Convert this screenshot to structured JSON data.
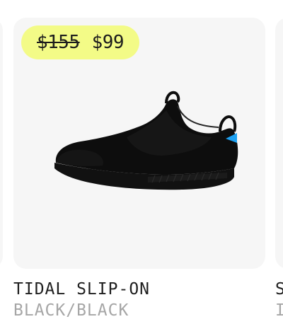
{
  "product": {
    "name": "TIDAL SLIP-ON",
    "color": "BLACK/BLACK",
    "price_original": "$155",
    "price_sale": "$99",
    "image_icon": "black-slip-on-sneaker",
    "accent_color": "#1da1f2"
  },
  "colors": {
    "badge_background": "#f3fb87",
    "card_background": "#f6f6f6",
    "name_text": "#1f1f1f",
    "color_text": "#a6a6a6"
  },
  "next_card": {
    "name_initial": "S",
    "color_initial": "I"
  }
}
